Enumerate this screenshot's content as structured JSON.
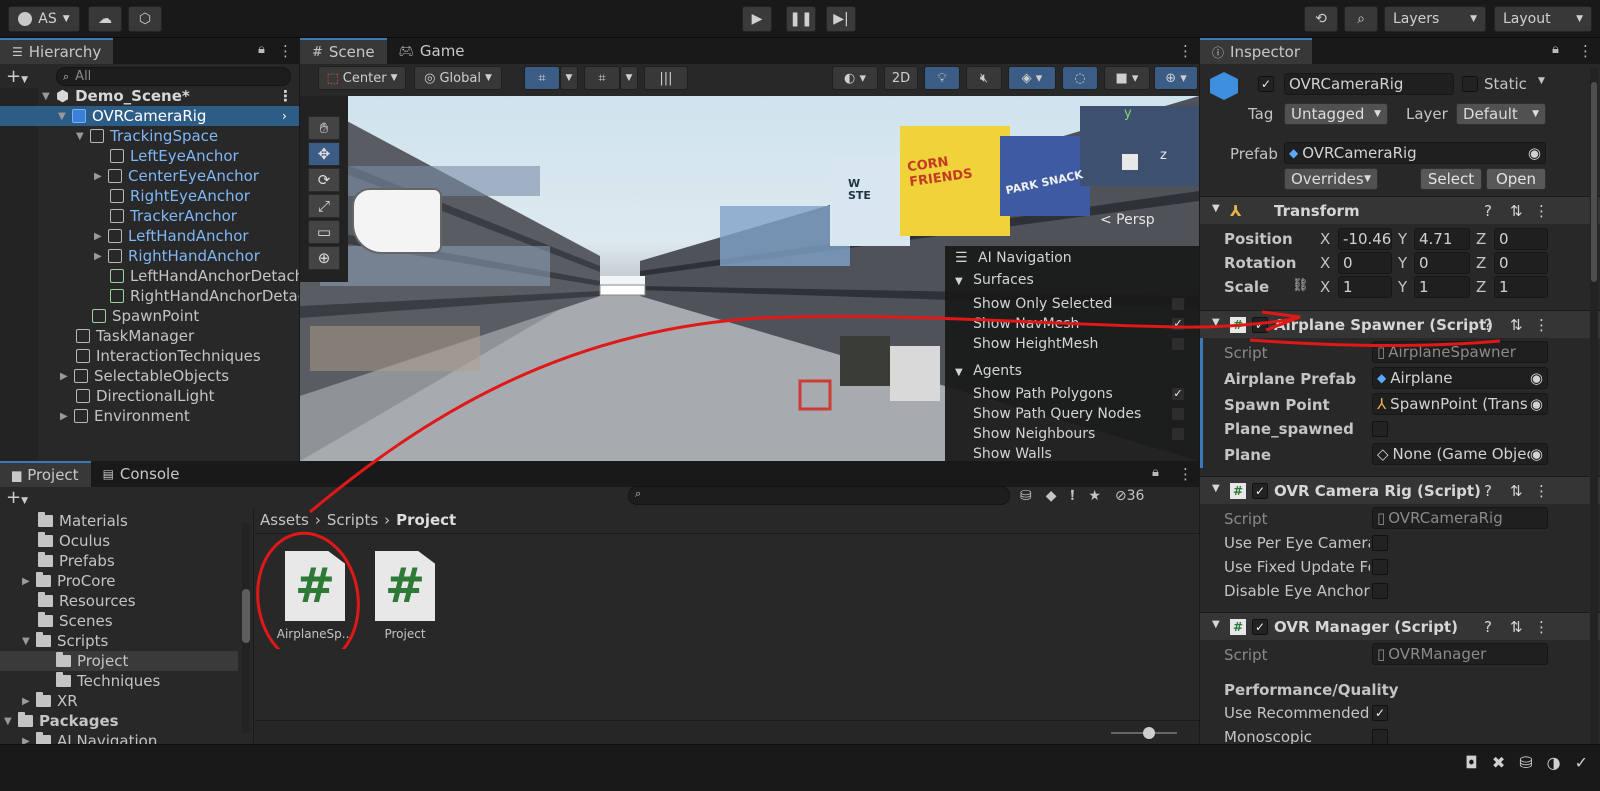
{
  "toolbar": {
    "account": "AS",
    "layers": "Layers",
    "layout": "Layout"
  },
  "hierarchy": {
    "tab": "Hierarchy",
    "search_placeholder": "All",
    "scene": "Demo_Scene*",
    "items": [
      {
        "label": "OVRCameraRig"
      },
      {
        "label": "TrackingSpace"
      },
      {
        "label": "LeftEyeAnchor"
      },
      {
        "label": "CenterEyeAnchor"
      },
      {
        "label": "RightEyeAnchor"
      },
      {
        "label": "TrackerAnchor"
      },
      {
        "label": "LeftHandAnchor"
      },
      {
        "label": "RightHandAnchor"
      },
      {
        "label": "LeftHandAnchorDetach"
      },
      {
        "label": "RightHandAnchorDetac"
      },
      {
        "label": "SpawnPoint"
      },
      {
        "label": "TaskManager"
      },
      {
        "label": "InteractionTechniques"
      },
      {
        "label": "SelectableObjects"
      },
      {
        "label": "DirectionalLight"
      },
      {
        "label": "Environment"
      }
    ]
  },
  "scene": {
    "tab_scene": "Scene",
    "tab_game": "Game",
    "pivot": "Center",
    "space": "Global",
    "mode_2d": "2D",
    "persp": "< Persp",
    "gizmo_y": "y",
    "gizmo_z": "z"
  },
  "ai_nav": {
    "title": "AI Navigation",
    "surfaces": "Surfaces",
    "show_only_selected": "Show Only Selected",
    "show_navmesh": "Show NavMesh",
    "show_heightmesh": "Show HeightMesh",
    "agents": "Agents",
    "show_path_polygons": "Show Path Polygons",
    "show_path_query_nodes": "Show Path Query Nodes",
    "show_neighbours": "Show Neighbours",
    "show_walls": "Show Walls"
  },
  "project": {
    "tab_project": "Project",
    "tab_console": "Console",
    "hidden_count": "36",
    "folders": [
      {
        "label": "Materials"
      },
      {
        "label": "Oculus"
      },
      {
        "label": "Prefabs"
      },
      {
        "label": "ProCore"
      },
      {
        "label": "Resources"
      },
      {
        "label": "Scenes"
      },
      {
        "label": "Scripts"
      },
      {
        "label": "Project"
      },
      {
        "label": "Techniques"
      },
      {
        "label": "XR"
      },
      {
        "label": "Packages"
      },
      {
        "label": "AI Navigation"
      }
    ],
    "breadcrumb": [
      "Assets",
      "Scripts",
      "Project"
    ],
    "assets": [
      {
        "label": "AirplaneSp..."
      },
      {
        "label": "Project"
      }
    ]
  },
  "inspector": {
    "tab": "Inspector",
    "object_name": "OVRCameraRig",
    "static": "Static",
    "tag_label": "Tag",
    "tag_value": "Untagged",
    "layer_label": "Layer",
    "layer_value": "Default",
    "prefab_label": "Prefab",
    "prefab_value": "OVRCameraRig",
    "overrides": "Overrides",
    "select": "Select",
    "open": "Open",
    "transform": {
      "title": "Transform",
      "position": "Position",
      "rotation": "Rotation",
      "scale": "Scale",
      "pos_x": "-10.46",
      "pos_y": "4.71",
      "pos_z": "0",
      "rot_x": "0",
      "rot_y": "0",
      "rot_z": "0",
      "scl_x": "1",
      "scl_y": "1",
      "scl_z": "1",
      "x": "X",
      "y": "Y",
      "z": "Z"
    },
    "airplane_spawner": {
      "title": "Airplane Spawner (Script)",
      "script_label": "Script",
      "script_value": "AirplaneSpawner",
      "prefab_label": "Airplane Prefab",
      "prefab_value": "Airplane",
      "spawn_label": "Spawn Point",
      "spawn_value": "SpawnPoint (Trans",
      "spawned_label": "Plane_spawned",
      "plane_label": "Plane",
      "plane_value": "None (Game Objec"
    },
    "ovr_camera_rig": {
      "title": "OVR Camera Rig (Script)",
      "script_label": "Script",
      "script_value": "OVRCameraRig",
      "per_eye": "Use Per Eye Cameras",
      "fixed_update": "Use Fixed Update Fo",
      "disable_eye": "Disable Eye Anchor C"
    },
    "ovr_manager": {
      "title": "OVR Manager (Script)",
      "script_label": "Script",
      "script_value": "OVRManager",
      "section": "Performance/Quality",
      "use_recommended": "Use Recommended I",
      "monoscopic": "Monoscopic"
    }
  },
  "viewport_signs": {
    "corn": "CORN FRIENDS",
    "park": "PARK SNACK",
    "water": "W STE"
  }
}
